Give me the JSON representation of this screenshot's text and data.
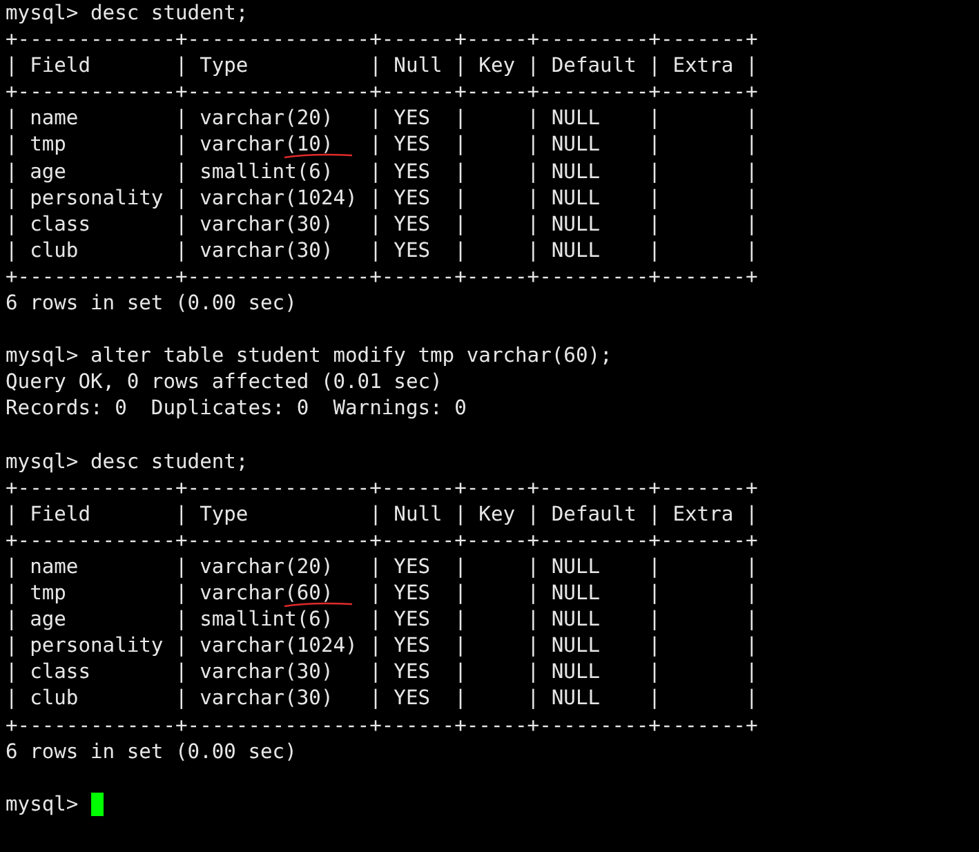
{
  "terminal": {
    "lines": [
      {
        "kind": "text",
        "text": "mysql> desc student;"
      },
      {
        "kind": "border",
        "text": "+-------------+---------------+------+-----+---------+-------+"
      },
      {
        "kind": "text",
        "text": "| Field       | Type          | Null | Key | Default | Extra |"
      },
      {
        "kind": "border",
        "text": "+-------------+---------------+------+-----+---------+-------+"
      },
      {
        "kind": "text",
        "text": "| name        | varchar(20)   | YES  |     | NULL    |       |",
        "underlined": false
      },
      {
        "kind": "text",
        "text": "| tmp         | varchar(10)   | YES  |     | NULL    |       |",
        "underlined": true
      },
      {
        "kind": "text",
        "text": "| age         | smallint(6)   | YES  |     | NULL    |       |",
        "underlined": false
      },
      {
        "kind": "text",
        "text": "| personality | varchar(1024) | YES  |     | NULL    |       |",
        "underlined": false
      },
      {
        "kind": "text",
        "text": "| class       | varchar(30)   | YES  |     | NULL    |       |",
        "underlined": false
      },
      {
        "kind": "text",
        "text": "| club        | varchar(30)   | YES  |     | NULL    |       |",
        "underlined": false
      },
      {
        "kind": "border",
        "text": "+-------------+---------------+------+-----+---------+-------+"
      },
      {
        "kind": "text",
        "text": "6 rows in set (0.00 sec)"
      },
      {
        "kind": "blank"
      },
      {
        "kind": "text",
        "text": "mysql> alter table student modify tmp varchar(60);"
      },
      {
        "kind": "text",
        "text": "Query OK, 0 rows affected (0.01 sec)"
      },
      {
        "kind": "text",
        "text": "Records: 0  Duplicates: 0  Warnings: 0"
      },
      {
        "kind": "blank"
      },
      {
        "kind": "text",
        "text": "mysql> desc student;"
      },
      {
        "kind": "border",
        "text": "+-------------+---------------+------+-----+---------+-------+"
      },
      {
        "kind": "text",
        "text": "| Field       | Type          | Null | Key | Default | Extra |"
      },
      {
        "kind": "border",
        "text": "+-------------+---------------+------+-----+---------+-------+"
      },
      {
        "kind": "text",
        "text": "| name        | varchar(20)   | YES  |     | NULL    |       |",
        "underlined": false
      },
      {
        "kind": "text",
        "text": "| tmp         | varchar(60)   | YES  |     | NULL    |       |",
        "underlined": true
      },
      {
        "kind": "text",
        "text": "| age         | smallint(6)   | YES  |     | NULL    |       |",
        "underlined": false
      },
      {
        "kind": "text",
        "text": "| personality | varchar(1024) | YES  |     | NULL    |       |",
        "underlined": false
      },
      {
        "kind": "text",
        "text": "| class       | varchar(30)   | YES  |     | NULL    |       |",
        "underlined": false
      },
      {
        "kind": "text",
        "text": "| club        | varchar(30)   | YES  |     | NULL    |       |",
        "underlined": false
      },
      {
        "kind": "border",
        "text": "+-------------+---------------+------+-----+---------+-------+"
      },
      {
        "kind": "text",
        "text": "6 rows in set (0.00 sec)"
      },
      {
        "kind": "blank"
      },
      {
        "kind": "text",
        "text": "mysql> ",
        "cursor": true
      }
    ]
  }
}
